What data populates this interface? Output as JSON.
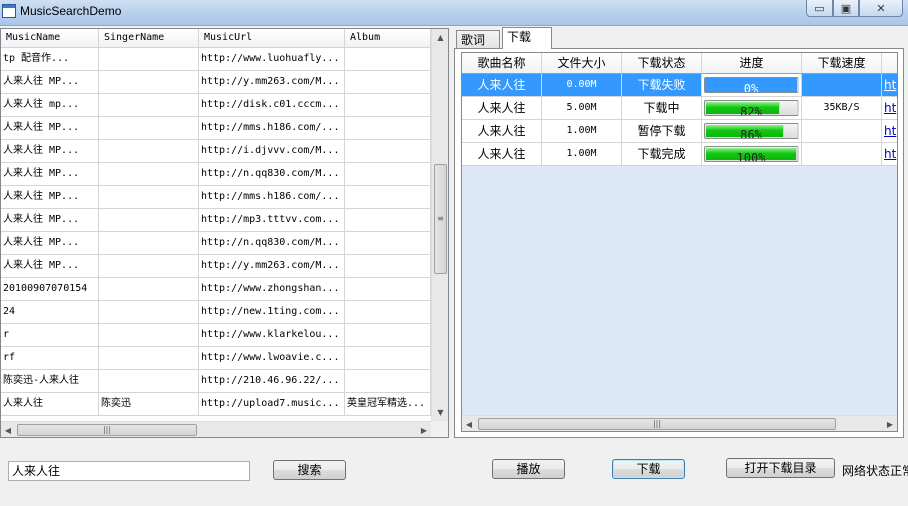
{
  "window": {
    "title": "MusicSearchDemo",
    "min_glyph": "▭",
    "max_glyph": "▣",
    "close_glyph": "✕"
  },
  "left_grid": {
    "columns": [
      "MusicName",
      "SingerName",
      "MusicUrl",
      "Album"
    ],
    "rows": [
      [
        "  tp 配音作...",
        "",
        "http://www.luohuafly...",
        ""
      ],
      [
        "人来人往  MP...",
        "",
        "http://y.mm263.com/M...",
        ""
      ],
      [
        "人来人往  mp...",
        "",
        "http://disk.c01.cccm...",
        ""
      ],
      [
        "人来人往  MP...",
        "",
        "http://mms.h186.com/...",
        ""
      ],
      [
        "人来人往  MP...",
        "",
        "http://i.djvvv.com/M...",
        ""
      ],
      [
        "人来人往  MP...",
        "",
        "http://n.qq830.com/M...",
        ""
      ],
      [
        "人来人往  MP...",
        "",
        "http://mms.h186.com/...",
        ""
      ],
      [
        "人来人往  MP...",
        "",
        "http://mp3.tttvv.com...",
        ""
      ],
      [
        "人来人往  MP...",
        "",
        "http://n.qq830.com/M...",
        ""
      ],
      [
        "人来人往  MP...",
        "",
        "http://y.mm263.com/M...",
        ""
      ],
      [
        "20100907070154",
        "",
        "http://www.zhongshan...",
        ""
      ],
      [
        "24",
        "",
        "http://new.1ting.com...",
        ""
      ],
      [
        "r",
        "",
        "http://www.klarkelou...",
        ""
      ],
      [
        "rf",
        "",
        "http://www.lwoavie.c...",
        ""
      ],
      [
        "陈奕迅-人来人往",
        "",
        "http://210.46.96.22/...",
        ""
      ],
      [
        "人来人往",
        "陈奕迅",
        "http://upload7.music...",
        "英皇冠军精选..."
      ]
    ],
    "scroll_up": "▲",
    "scroll_down": "▼",
    "scroll_left": "◀",
    "scroll_right": "▶",
    "thumb_grip_v": "≡",
    "thumb_grip_h": "|||"
  },
  "tabs": {
    "lyrics": "歌词",
    "download": "下载"
  },
  "download_grid": {
    "columns": [
      "歌曲名称",
      "文件大小",
      "下载状态",
      "进度",
      "下载速度",
      ""
    ],
    "rows": [
      {
        "name": "人来人往",
        "size": "0.00M",
        "status": "下载失败",
        "progress": 0,
        "progress_label": "0%",
        "speed": "",
        "link": "ht",
        "selected": true
      },
      {
        "name": "人来人往",
        "size": "5.00M",
        "status": "下载中",
        "progress": 82,
        "progress_label": "82%",
        "speed": "35KB/S",
        "link": "ht",
        "selected": false
      },
      {
        "name": "人来人往",
        "size": "1.00M",
        "status": "暂停下载",
        "progress": 86,
        "progress_label": "86%",
        "speed": "",
        "link": "ht",
        "selected": false
      },
      {
        "name": "人来人往",
        "size": "1.00M",
        "status": "下载完成",
        "progress": 100,
        "progress_label": "100%",
        "speed": "",
        "link": "ht",
        "selected": false
      }
    ]
  },
  "controls": {
    "search_value": "人来人往",
    "search_button": "搜索",
    "play_button": "播放",
    "download_button": "下载",
    "open_dir_button": "打开下载目录",
    "network_status": "网络状态正常"
  },
  "colors": {
    "selection": "#3399ff",
    "progress_green": "#13c713",
    "link_blue": "#0000cc"
  }
}
